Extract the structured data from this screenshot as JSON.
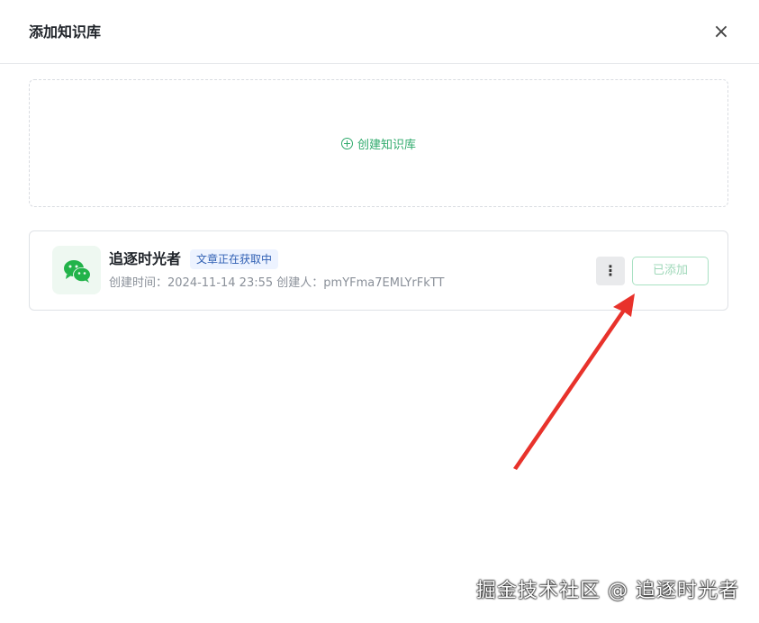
{
  "dialog": {
    "title": "添加知识库",
    "close_label": "×"
  },
  "create": {
    "label": "创建知识库"
  },
  "knowledge_base": {
    "name": "追逐时光者",
    "status_badge": "文章正在获取中",
    "meta": "创建时间：2024-11-14 23:55 创建人：pmYFma7EMLYrFkTT",
    "more_label": "⋮",
    "added_label": "已添加",
    "icon": "wechat-icon"
  },
  "watermark": {
    "text": "掘金技术社区 @ 追逐时光者"
  },
  "colors": {
    "accent": "#2eaa6b",
    "arrow": "#e8322b",
    "badge_bg": "#edf3ff"
  }
}
